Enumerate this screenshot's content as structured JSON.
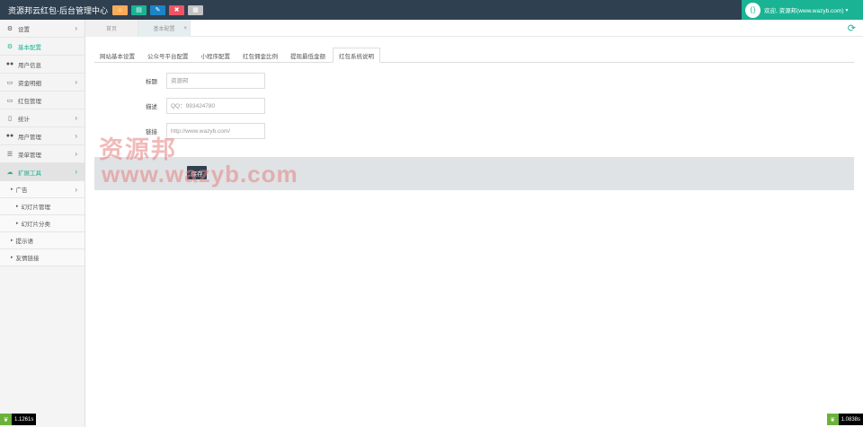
{
  "header": {
    "title": "资源邦云红包-后台管理中心",
    "quick_buttons": [
      {
        "icon": "home-icon",
        "glyph": "⌂",
        "color": "#f8ac59"
      },
      {
        "icon": "list-icon",
        "glyph": "▤",
        "color": "#1ab394"
      },
      {
        "icon": "edit-icon",
        "glyph": "✎",
        "color": "#1c84c6"
      },
      {
        "icon": "delete-icon",
        "glyph": "✖",
        "color": "#ed5565"
      },
      {
        "icon": "tag-icon",
        "glyph": "▦",
        "color": "#c2c2c2"
      }
    ],
    "welcome": "欢迎, 资源邦(www.wazyb.com)",
    "accent_color": "#1ab394"
  },
  "sidebar": {
    "items": [
      {
        "label": "设置",
        "icon": "gears-icon",
        "glyph": "⚙",
        "arrow": "›"
      },
      {
        "label": "基本配置",
        "icon": "gears-icon",
        "glyph": "⚙",
        "arrow": ""
      },
      {
        "label": "用户信息",
        "icon": "users-icon",
        "glyph": "👥",
        "arrow": ""
      },
      {
        "label": "资金明细",
        "icon": "monitor-icon",
        "glyph": "▭",
        "arrow": "›"
      },
      {
        "label": "红包管理",
        "icon": "monitor-icon",
        "glyph": "▭",
        "arrow": ""
      },
      {
        "label": "统计",
        "icon": "file-icon",
        "glyph": "▯",
        "arrow": "›"
      },
      {
        "label": "用户管理",
        "icon": "users-icon",
        "glyph": "👥",
        "arrow": "›"
      },
      {
        "label": "菜单管理",
        "icon": "list-icon",
        "glyph": "☰",
        "arrow": "›"
      },
      {
        "label": "扩展工具",
        "icon": "cloud-icon",
        "glyph": "☁",
        "arrow": "›"
      }
    ],
    "sub_items": [
      {
        "label": "广告",
        "arrow": "›"
      },
      {
        "label": "幻灯片管理"
      },
      {
        "label": "幻灯片分类"
      },
      {
        "label": "提示语"
      },
      {
        "label": "友情链接"
      }
    ]
  },
  "tabs": {
    "home": "首页",
    "current": "基本配置",
    "close": "×",
    "refresh": "⟳"
  },
  "subtabs": [
    "网站基本设置",
    "公众号平台配置",
    "小程序配置",
    "红包佣金比例",
    "提现最低金额",
    "红包系统说明"
  ],
  "form": {
    "title_label": "标题",
    "title_value": "资源邦",
    "desc_label": "描述",
    "desc_value": "QQ：993424780",
    "link_label": "链接",
    "link_value": "http://www.wazyb.com/",
    "save_label": "保存"
  },
  "watermark": {
    "cn": "资源邦",
    "url": "www.wazyb.com"
  },
  "footer": {
    "left_badge": "1.1261s",
    "right_badge": "1.0838s"
  }
}
